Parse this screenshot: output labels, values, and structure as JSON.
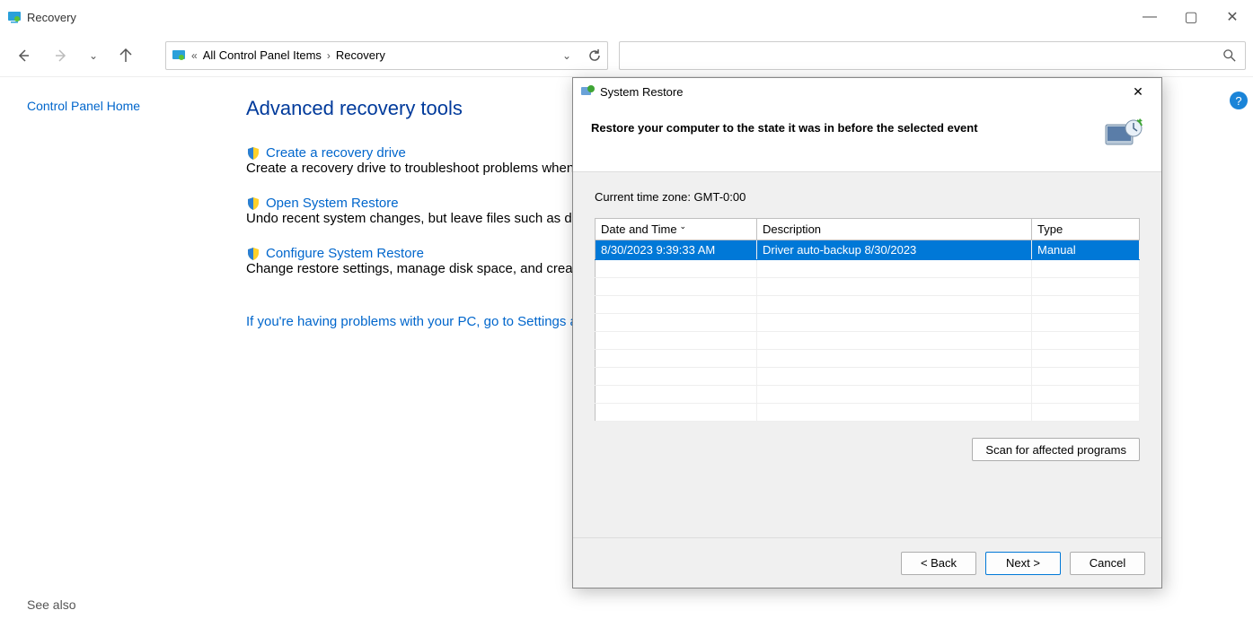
{
  "window": {
    "title": "Recovery"
  },
  "breadcrumb": {
    "root": "All Control Panel Items",
    "current": "Recovery"
  },
  "sidebar": {
    "home": "Control Panel Home",
    "seealso": "See also"
  },
  "main": {
    "heading": "Advanced recovery tools",
    "tools": [
      {
        "title": "Create a recovery drive",
        "desc": "Create a recovery drive to troubleshoot problems when"
      },
      {
        "title": "Open System Restore",
        "desc": "Undo recent system changes, but leave files such as doc"
      },
      {
        "title": "Configure System Restore",
        "desc": "Change restore settings, manage disk space, and create"
      }
    ],
    "tip": "If you're having problems with your PC, go to Settings a"
  },
  "dialog": {
    "title": "System Restore",
    "heading": "Restore your computer to the state it was in before the selected event",
    "timezone": "Current time zone: GMT-0:00",
    "columns": {
      "dt": "Date and Time",
      "desc": "Description",
      "type": "Type"
    },
    "rows": [
      {
        "dt": "8/30/2023 9:39:33 AM",
        "desc": "Driver auto-backup 8/30/2023",
        "type": "Manual"
      }
    ],
    "scan": "Scan for affected programs",
    "buttons": {
      "back": "< Back",
      "next": "Next >",
      "cancel": "Cancel"
    }
  }
}
